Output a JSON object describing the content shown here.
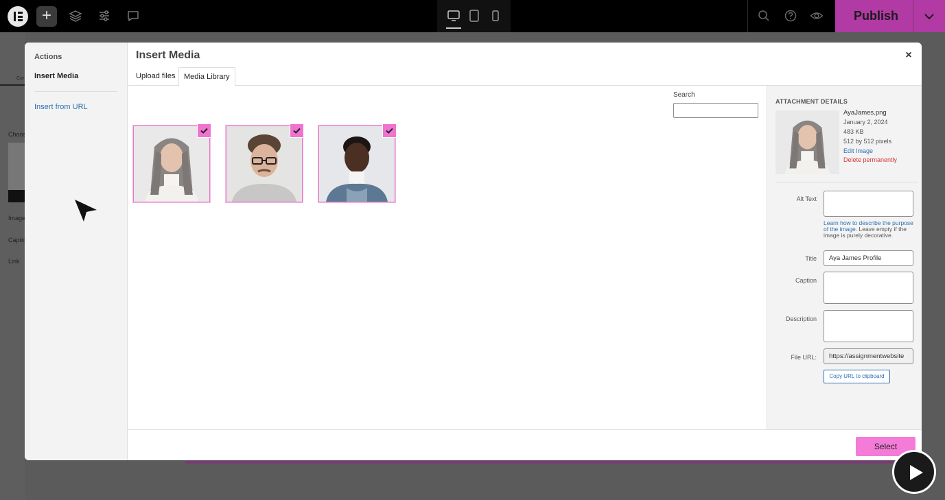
{
  "topbar": {
    "publish_label": "Publish",
    "icons": [
      "elementor-logo-icon",
      "plus-icon",
      "layers-icon",
      "settings-sliders-icon",
      "comment-icon",
      "desktop-icon",
      "tablet-icon",
      "mobile-icon",
      "search-icon",
      "help-icon",
      "eye-icon",
      "chevron-down-icon"
    ],
    "publish_color": "#b13aa4"
  },
  "background_panel": {
    "texts": [
      "Cor",
      "Choos",
      "Image",
      "Captio",
      "Link"
    ]
  },
  "modal": {
    "sidebar": {
      "heading": "Actions",
      "active_item": "Insert Media",
      "link_item": "Insert from URL"
    },
    "title": "Insert Media",
    "close_symbol": "×",
    "tabs": [
      {
        "label": "Upload files",
        "active": false
      },
      {
        "label": "Media Library",
        "active": true
      }
    ],
    "search": {
      "label": "Search",
      "value": ""
    },
    "media_items": [
      {
        "name": "woman-long-gray-hair",
        "selected": true
      },
      {
        "name": "man-glasses-curly-hair",
        "selected": true
      },
      {
        "name": "person-dark-skin-turtleneck",
        "selected": true
      }
    ],
    "details": {
      "heading": "ATTACHMENT DETAILS",
      "filename": "AyaJames.png",
      "date": "January 2, 2024",
      "size": "483 KB",
      "dimensions": "512 by 512 pixels",
      "edit_link": "Edit Image",
      "delete_link": "Delete permanently",
      "alt_text_label": "Alt Text",
      "alt_text_value": "",
      "help_link": "Learn how to describe the purpose of the image.",
      "help_text": " Leave empty if the image is purely decorative.",
      "title_label": "Title",
      "title_value": "Aya James Profile",
      "caption_label": "Caption",
      "caption_value": "",
      "description_label": "Description",
      "description_value": "",
      "file_url_label": "File URL:",
      "file_url_value": "https://assignmentwebsite",
      "copy_button": "Copy URL to clipboard"
    },
    "select_button": "Select",
    "accent_color": "#f47bd7"
  }
}
